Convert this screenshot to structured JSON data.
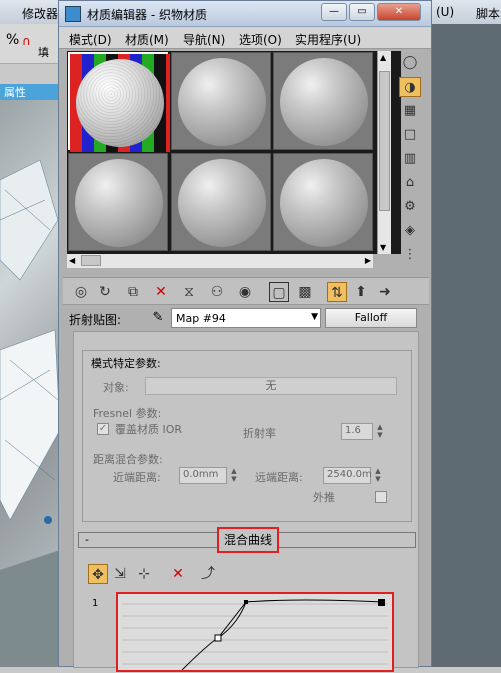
{
  "background_app": {
    "menu_left": "修改器",
    "menu_right_1": "(U)",
    "menu_right_2": "脚本",
    "tab_label": "属性",
    "tools_label": "填"
  },
  "window": {
    "title": "材质编辑器 - 织物材质",
    "minimize": "—",
    "restore": "▭",
    "close": "✕"
  },
  "menubar": [
    "模式(D)",
    "材质(M)",
    "导航(N)",
    "选项(O)",
    "实用程序(U)"
  ],
  "map_row": {
    "label": "折射贴图:",
    "map_name": "Map #94",
    "map_type": "Falloff"
  },
  "mode_params": {
    "title": "模式特定参数:",
    "object_label": "对象:",
    "object_value": "无",
    "fresnel_title": "Fresnel 参数:",
    "override_label": "覆盖材质 IOR",
    "override_checked": "✓",
    "ior_label": "折射率",
    "ior_value": "1.6",
    "distance_title": "距离混合参数:",
    "near_label": "近端距离:",
    "near_value": "0.0mm",
    "far_label": "远端距离:",
    "far_value": "2540.0m",
    "extrapolate_label": "外推"
  },
  "curve": {
    "collapse": "-",
    "title": "混合曲线",
    "y_max_label": "1"
  },
  "colors": {
    "highlight_red": "#e02020",
    "active_tool": "#f0c060"
  }
}
